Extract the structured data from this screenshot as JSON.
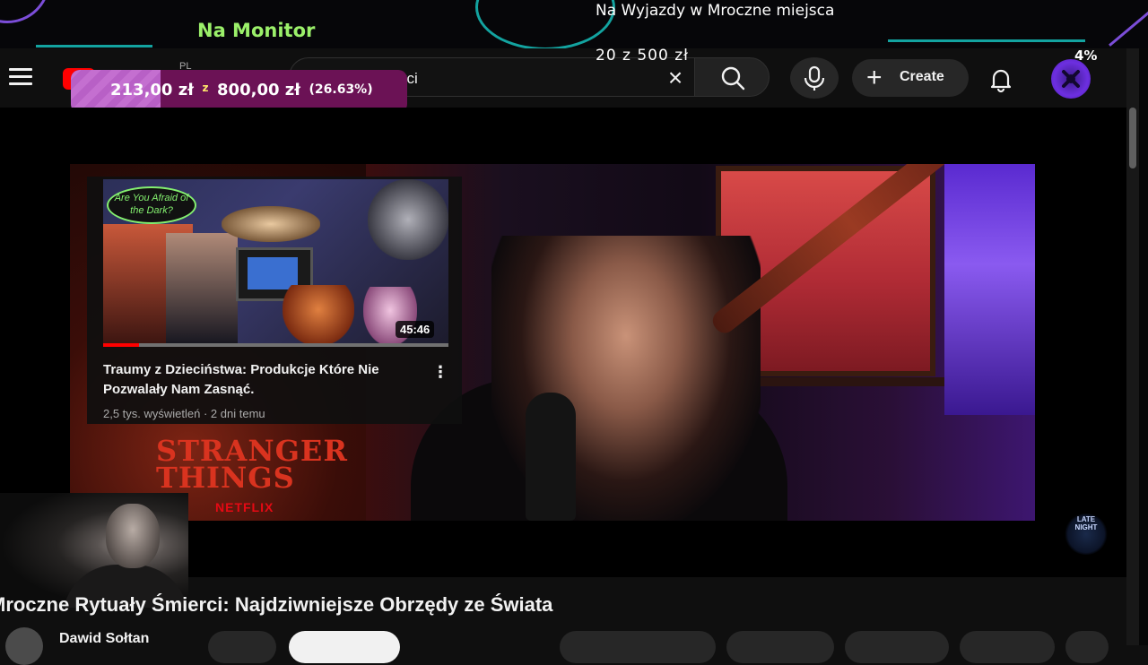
{
  "stream_overlay": {
    "goal_left_title": "Na Monitor",
    "goal_right_title": "Na Wyjazdy w Mroczne miejsca",
    "goal_right_amount": "20 z 500 zł",
    "goal_right_percent": "4%",
    "goal_bar": {
      "current": "213,00 zł",
      "separator": "z",
      "target": "800,00 zł",
      "percent_label": "(26.63%)",
      "progress_fraction": 0.2663
    }
  },
  "header": {
    "country_code": "PL",
    "search_value": "...rytuały śmierci",
    "create_label": "Create"
  },
  "suggested": {
    "title": "Traumy z Dzieciństwa: Produkcje Które Nie Pozwalały Nam Zasnąć.",
    "meta": "2,5 tys. wyświetleń · 2 dni temu",
    "duration": "45:46",
    "thumb_badge": "Are You Afraid of the Dark?"
  },
  "video": {
    "title": "Mroczne Rytuały Śmierci: Najdziwniejsze Obrzędy ze Świata",
    "poster_text": "STRANGER THINGS",
    "poster_brand": "NETFLIX",
    "watermark": "LATE NIGHT"
  },
  "channel": {
    "name": "Dawid Sołtan"
  },
  "colors": {
    "goal_green": "#9bf06a",
    "goal_bar_bg": "#6b1255",
    "goal_bar_fill": "#c46fd0",
    "accent_teal": "#13a3a0",
    "yt_red": "#ff0000"
  }
}
